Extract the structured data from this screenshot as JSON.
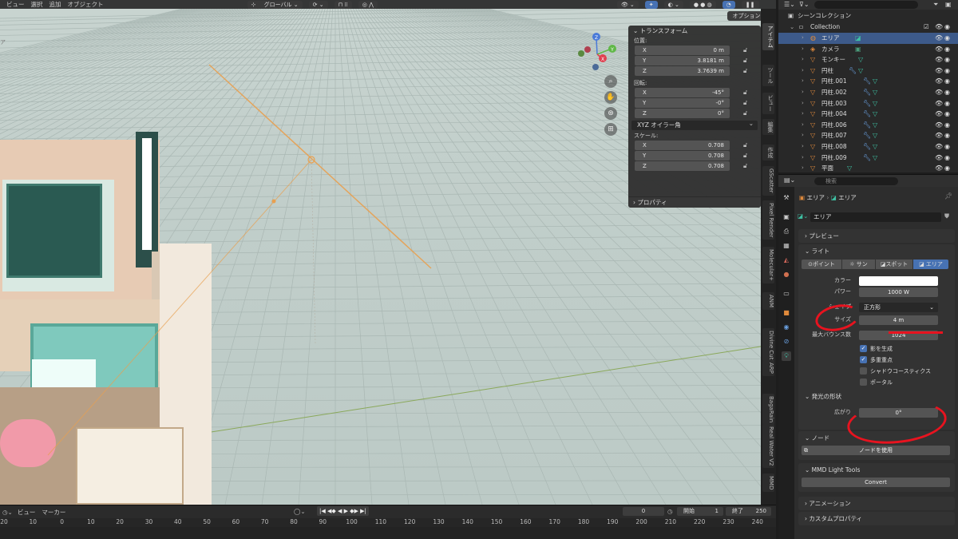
{
  "viewport": {
    "menu": [
      "ビュー",
      "選択",
      "追加",
      "オブジェクト"
    ],
    "orientation": "グローバル",
    "options_label": "オプション",
    "side_label": "ア"
  },
  "transform_panel": {
    "title": "トランスフォーム",
    "location_label": "位置:",
    "location": [
      {
        "axis": "X",
        "value": "0 m"
      },
      {
        "axis": "Y",
        "value": "3.8181 m"
      },
      {
        "axis": "Z",
        "value": "3.7639 m"
      }
    ],
    "rotation_label": "回転:",
    "rotation": [
      {
        "axis": "X",
        "value": "-45°"
      },
      {
        "axis": "Y",
        "value": "-0°"
      },
      {
        "axis": "Z",
        "value": "0°"
      }
    ],
    "rotation_mode": "XYZ オイラー角",
    "scale_label": "スケール:",
    "scale": [
      {
        "axis": "X",
        "value": "0.708"
      },
      {
        "axis": "Y",
        "value": "0.708"
      },
      {
        "axis": "Z",
        "value": "0.708"
      }
    ],
    "properties_label": "プロパティ"
  },
  "vertical_tabs": [
    "アイテム",
    "ツール",
    "ビュー",
    "編集",
    "作成",
    "GScatter",
    "Pixel Render",
    "Molecular+",
    "ANM",
    "Divine Cut",
    "ARP",
    "BagaRain",
    "Real Water V2",
    "MMD"
  ],
  "timeline": {
    "menu": [
      "ビュー",
      "マーカー"
    ],
    "current_frame": "0",
    "start_label": "開始",
    "start": "1",
    "end_label": "終了",
    "end": "250",
    "ticks": [
      "20",
      "10",
      "0",
      "10",
      "20",
      "30",
      "40",
      "50",
      "60",
      "70",
      "80",
      "90",
      "100",
      "110",
      "120",
      "130",
      "140",
      "150",
      "160",
      "170",
      "180",
      "190",
      "200",
      "210",
      "220",
      "230",
      "240",
      "250"
    ]
  },
  "outliner": {
    "scene_collection": "シーンコレクション",
    "collection": "Collection",
    "items": [
      {
        "name": "エリア",
        "selected": true
      },
      {
        "name": "カメラ",
        "selected": false
      },
      {
        "name": "モンキー",
        "selected": false
      },
      {
        "name": "円柱",
        "selected": false
      },
      {
        "name": "円柱.001",
        "selected": false
      },
      {
        "name": "円柱.002",
        "selected": false
      },
      {
        "name": "円柱.003",
        "selected": false
      },
      {
        "name": "円柱.004",
        "selected": false
      },
      {
        "name": "円柱.006",
        "selected": false
      },
      {
        "name": "円柱.007",
        "selected": false
      },
      {
        "name": "円柱.008",
        "selected": false
      },
      {
        "name": "円柱.009",
        "selected": false
      },
      {
        "name": "平面",
        "selected": false
      }
    ]
  },
  "properties": {
    "search_placeholder": "検索",
    "breadcrumb_object": "エリア",
    "breadcrumb_data": "エリア",
    "datablock_name": "エリア",
    "preview_label": "プレビュー",
    "light_label": "ライト",
    "light_types": [
      "ポイント",
      "サン",
      "スポット",
      "エリア"
    ],
    "active_light_type": "エリア",
    "color_label": "カラー",
    "color_value": "#ffffff",
    "power_label": "パワー",
    "power_value": "1000 W",
    "shape_label": "シェイプ",
    "shape_value": "正方形",
    "size_label": "サイズ",
    "size_value": "4 m",
    "max_bounces_label": "最大バウンス数",
    "max_bounces_value": "1024",
    "checkboxes": [
      {
        "label": "影を生成",
        "checked": true
      },
      {
        "label": "多重重点",
        "checked": true
      },
      {
        "label": "シャドウコースティクス",
        "checked": false
      },
      {
        "label": "ポータル",
        "checked": false
      }
    ],
    "beam_shape_label": "発光の形状",
    "spread_label": "広がり",
    "spread_value": "0°",
    "nodes_label": "ノード",
    "use_nodes_label": "ノードを使用",
    "mmd_label": "MMD Light Tools",
    "convert_label": "Convert",
    "animation_label": "アニメーション",
    "custom_props_label": "カスタムプロパティ"
  },
  "colors": {
    "accent": "#4772b3",
    "selection": "#3d5a8a",
    "annotation": "#e8131f",
    "light_line": "#e8a050"
  }
}
